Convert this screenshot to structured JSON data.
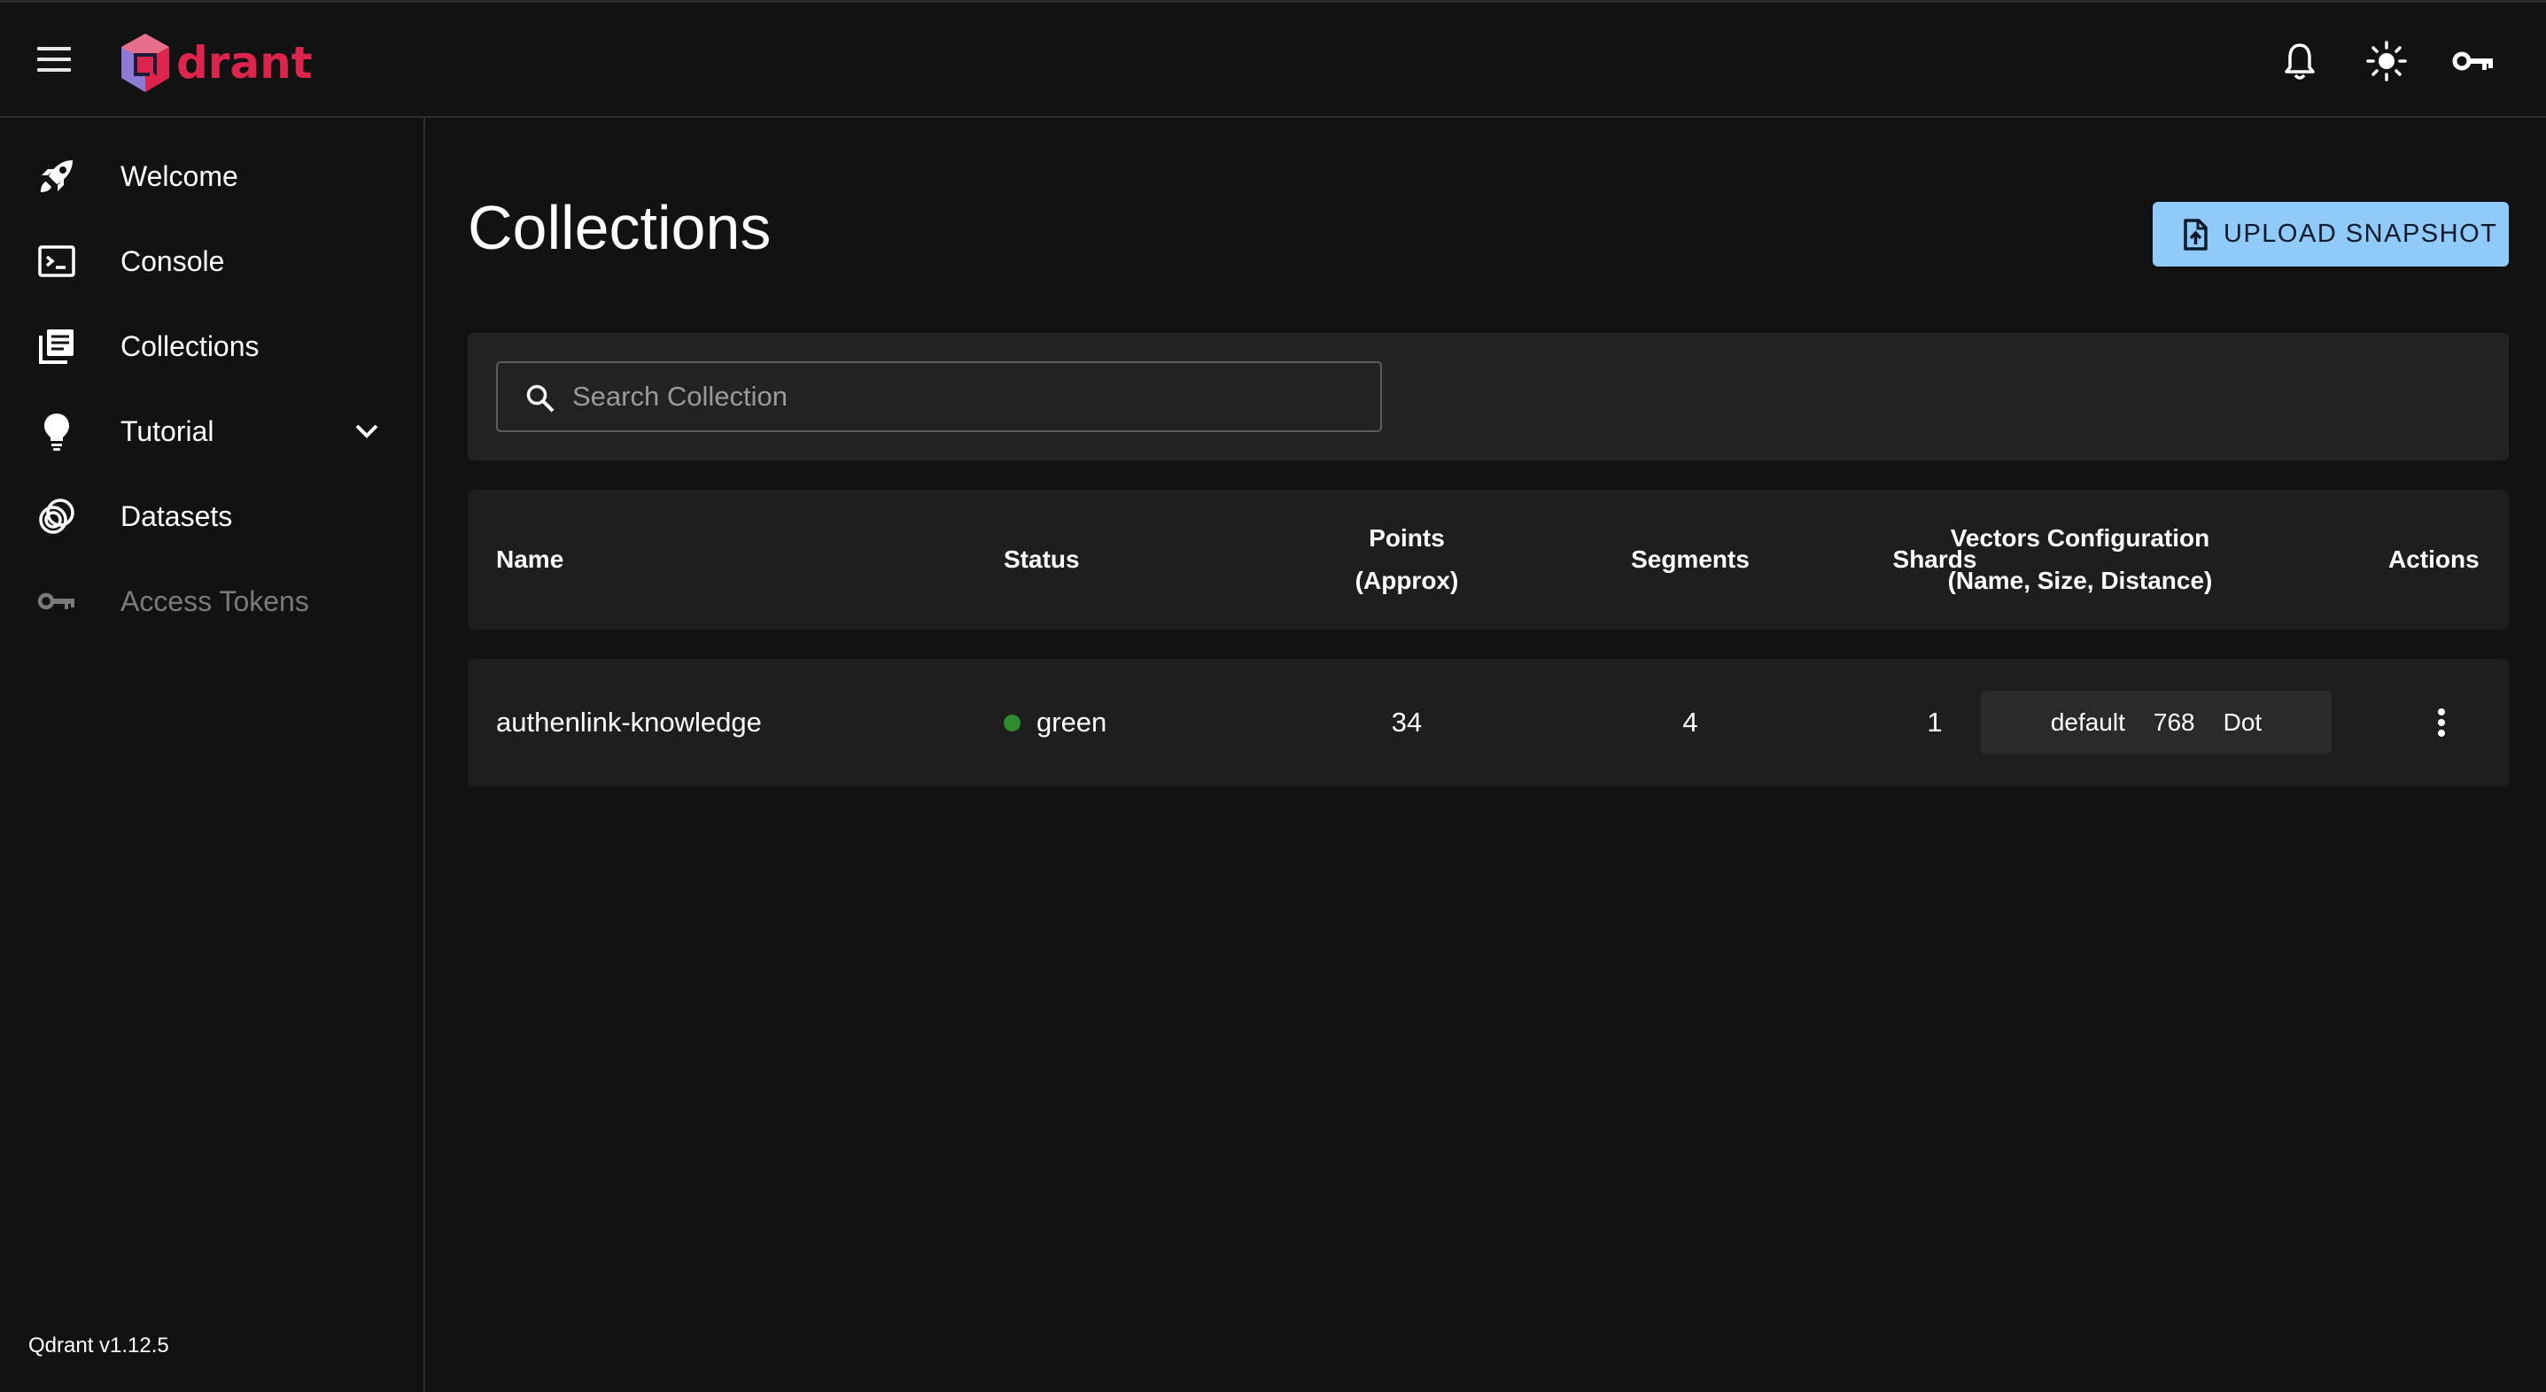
{
  "app": {
    "logo_text": "drant",
    "brand_color": "#dc244c",
    "accent_color": "#90caf9"
  },
  "topbar": {
    "icons": [
      "menu-icon",
      "bell-icon",
      "sun-icon",
      "key-icon"
    ]
  },
  "sidebar": {
    "items": [
      {
        "label": "Welcome",
        "icon": "rocket-icon"
      },
      {
        "label": "Console",
        "icon": "terminal-icon"
      },
      {
        "label": "Collections",
        "icon": "collections-icon"
      },
      {
        "label": "Tutorial",
        "icon": "lightbulb-icon"
      },
      {
        "label": "Datasets",
        "icon": "datasets-icon"
      },
      {
        "label": "Access Tokens",
        "icon": "key-icon"
      }
    ],
    "version": "Qdrant v1.12.5"
  },
  "main": {
    "title": "Collections",
    "upload_button": "UPLOAD SNAPSHOT",
    "search": {
      "placeholder": "Search Collection",
      "value": ""
    },
    "table": {
      "headers": {
        "name": "Name",
        "status": "Status",
        "points_line1": "Points",
        "points_line2": "(Approx)",
        "segments": "Segments",
        "shards": "Shards",
        "vectors_line1": "Vectors Configuration",
        "vectors_line2": "(Name, Size, Distance)",
        "actions": "Actions"
      },
      "rows": [
        {
          "name": "authenlink-knowledge",
          "status": "green",
          "status_color": "#2e8b2e",
          "points": "34",
          "segments": "4",
          "shards": "1",
          "vector_name": "default",
          "vector_size": "768",
          "vector_distance": "Dot"
        }
      ]
    }
  }
}
